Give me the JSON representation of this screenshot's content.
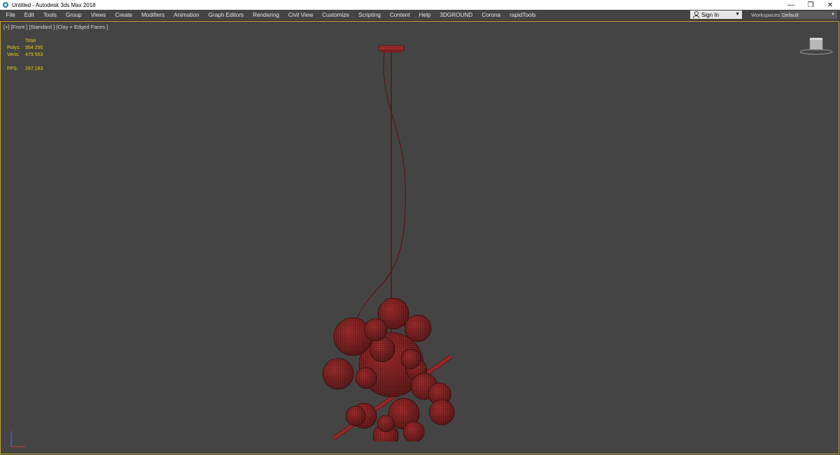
{
  "window": {
    "title": "Untitled - Autodesk 3ds Max 2018",
    "controls": {
      "minimize": "—",
      "restore": "❐",
      "close": "✕"
    }
  },
  "menu": {
    "items": [
      "File",
      "Edit",
      "Tools",
      "Group",
      "Views",
      "Create",
      "Modifiers",
      "Animation",
      "Graph Editors",
      "Rendering",
      "Civil View",
      "Customize",
      "Scripting",
      "Content",
      "Help",
      "3DGROUND",
      "Corona",
      "rapidTools"
    ],
    "sign_in": "Sign In",
    "workspaces_label": "Workspaces:",
    "workspaces_value": "Default"
  },
  "viewport": {
    "label": "[+] [Front ] [Standard ] [Clay + Edged Faces ]",
    "stats": {
      "header": "Total",
      "polys_label": "Polys:",
      "polys_value": "954 256",
      "verts_label": "Verts:",
      "verts_value": "479 553",
      "fps_label": "FPS:",
      "fps_value": "287,183"
    }
  },
  "colors": {
    "viewport_bg": "#444444",
    "viewport_border": "#c8a43a",
    "stats_text": "#e6d200",
    "model_fill": "#a42e2e",
    "model_wire": "#4a0d0d"
  }
}
